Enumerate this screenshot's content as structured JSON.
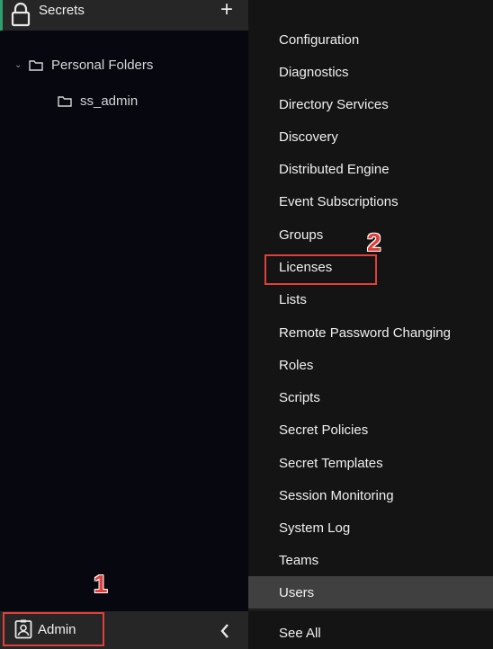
{
  "sidebar": {
    "title": "Secrets",
    "add_label": "+",
    "tree": {
      "root": "Personal Folders",
      "children": [
        "ss_admin"
      ]
    },
    "footer": {
      "admin_label": "Admin",
      "collapse_label": "‹"
    }
  },
  "admin_menu": {
    "items": [
      "Configuration",
      "Diagnostics",
      "Directory Services",
      "Discovery",
      "Distributed Engine",
      "Event Subscriptions",
      "Groups",
      "Licenses",
      "Lists",
      "Remote Password Changing",
      "Roles",
      "Scripts",
      "Secret Policies",
      "Secret Templates",
      "Session Monitoring",
      "System Log",
      "Teams",
      "Users"
    ],
    "active_item": "Users",
    "see_all_label": "See All"
  },
  "annotations": {
    "step1": "1",
    "step2": "2",
    "color": "#e0403a"
  }
}
